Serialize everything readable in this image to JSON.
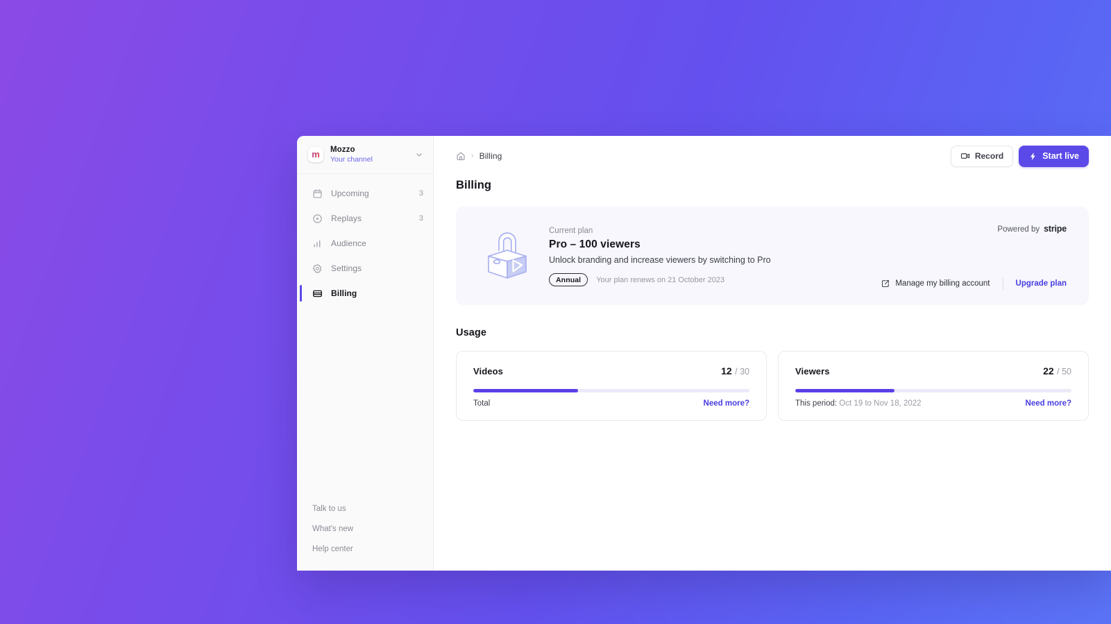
{
  "theme": {
    "accent": "#5b4ae8",
    "link": "#4a3de0",
    "bg_gradient_from": "#8b4ae6",
    "bg_gradient_to": "#5b74f7",
    "card_bg": "#f7f7fd"
  },
  "sidebar": {
    "workspace": {
      "logo_letter": "m",
      "name": "Mozzo",
      "subtitle": "Your channel",
      "chevron_icon": "chevron-down-icon"
    },
    "items": [
      {
        "label": "Upcoming",
        "count": "3",
        "icon": "calendar-icon",
        "active": false
      },
      {
        "label": "Replays",
        "count": "3",
        "icon": "play-circle-icon",
        "active": false
      },
      {
        "label": "Audience",
        "count": "",
        "icon": "bar-chart-icon",
        "active": false
      },
      {
        "label": "Settings",
        "count": "",
        "icon": "gear-icon",
        "active": false
      },
      {
        "label": "Billing",
        "count": "",
        "icon": "credit-card-icon",
        "active": true
      }
    ],
    "footer_links": [
      {
        "label": "Talk to us"
      },
      {
        "label": "What's new"
      },
      {
        "label": "Help center"
      }
    ]
  },
  "topbar": {
    "breadcrumb": {
      "home_icon": "home-icon",
      "separator": "›",
      "current": "Billing"
    },
    "record_label": "Record",
    "record_icon": "video-camera-icon",
    "live_label": "Start live",
    "live_icon": "lightning-bolt-icon"
  },
  "page": {
    "title": "Billing",
    "usage_title": "Usage"
  },
  "plan": {
    "illustration": "padlock-play-illustration",
    "eyebrow": "Current plan",
    "name": "Pro – 100 viewers",
    "description": "Unlock branding and increase viewers by switching to Pro",
    "billing_cycle": "Annual",
    "renews": "Your plan renews on 21 October 2023",
    "powered_by_label": "Powered by",
    "powered_by_brand": "stripe",
    "manage_label": "Manage my billing account",
    "manage_icon": "external-link-icon",
    "upgrade_label": "Upgrade plan"
  },
  "usage": {
    "cards": [
      {
        "name": "Videos",
        "used": "12",
        "limit": "/ 30",
        "percent": 38,
        "sub_label": "Total",
        "sub_value": "",
        "action_label": "Need more?"
      },
      {
        "name": "Viewers",
        "used": "22",
        "limit": "/ 50",
        "percent": 36,
        "sub_label": "This period:",
        "sub_value": " Oct 19 to Nov 18, 2022",
        "action_label": "Need more?"
      }
    ]
  }
}
